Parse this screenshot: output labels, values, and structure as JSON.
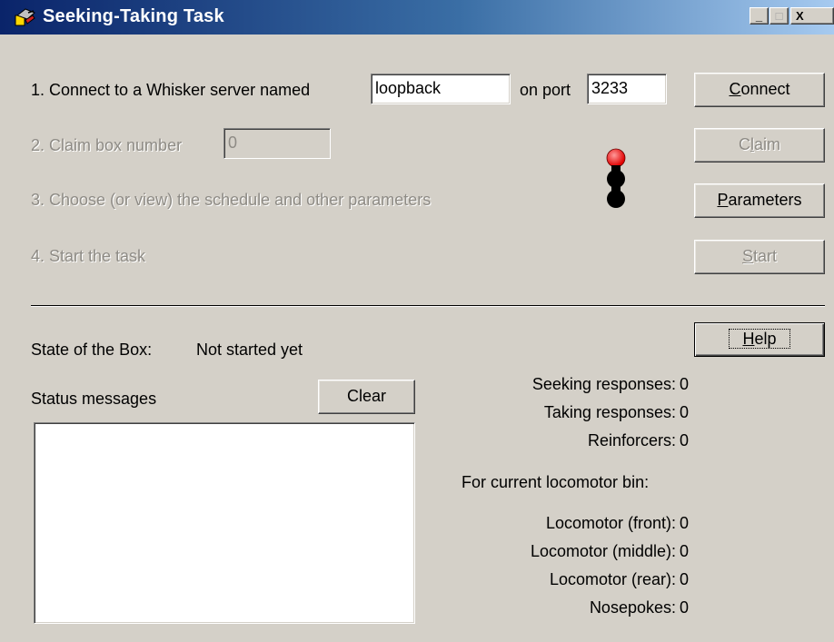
{
  "window": {
    "title": "Seeking-Taking Task",
    "icon": "app-icon",
    "caption_buttons": {
      "minimize": "_",
      "maximize": "□",
      "close": "X"
    }
  },
  "steps": {
    "step1_prefix": "1. Connect to a Whisker server named",
    "server_name": "loopback",
    "on_port_label": "on port",
    "port": "3233",
    "step2_label": "2. Claim box number",
    "box_number": "0",
    "step3_label": "3. Choose (or view) the schedule and other parameters",
    "step4_label": "4. Start the task"
  },
  "buttons": {
    "connect": {
      "mnemonic": "C",
      "rest": "onnect"
    },
    "claim": {
      "pre": "C",
      "mnemonic": "l",
      "rest": "aim"
    },
    "parameters": {
      "mnemonic": "P",
      "rest": "arameters"
    },
    "start": {
      "mnemonic": "S",
      "rest": "tart"
    },
    "help": {
      "mnemonic": "H",
      "rest": "elp"
    },
    "clear": "Clear"
  },
  "status": {
    "state_label": "State of the Box:",
    "state_value": "Not started yet",
    "messages_label": "Status messages"
  },
  "stats": {
    "seeking_label": "Seeking responses:",
    "seeking_value": "0",
    "taking_label": "Taking responses:",
    "taking_value": "0",
    "reinforcers_label": "Reinforcers:",
    "reinforcers_value": "0",
    "bin_header": "For current locomotor bin:",
    "loco_front_label": "Locomotor (front):",
    "loco_front_value": "0",
    "loco_middle_label": "Locomotor (middle):",
    "loco_middle_value": "0",
    "loco_rear_label": "Locomotor (rear):",
    "loco_rear_value": "0",
    "nosepokes_label": "Nosepokes:",
    "nosepokes_value": "0"
  },
  "indicator": {
    "icon": "traffic-light-icon",
    "colors": {
      "active": "#ff0000",
      "inactive": "#000000"
    }
  },
  "colors": {
    "titlebar_start": "#0a246a",
    "titlebar_end": "#a6caf0",
    "window_face": "#d4d0c8"
  }
}
